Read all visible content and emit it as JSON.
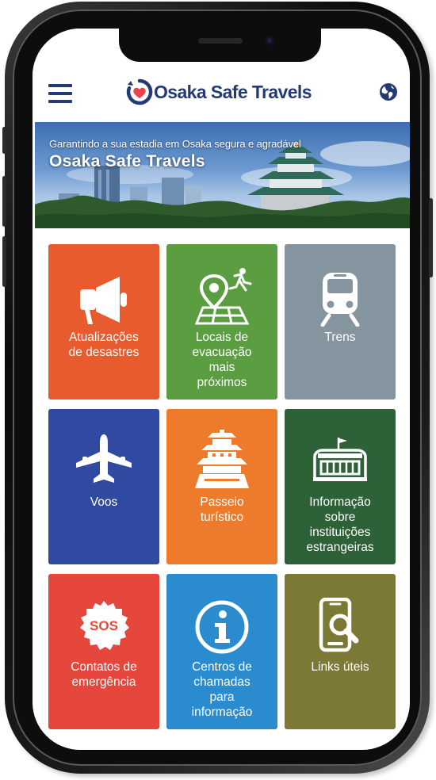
{
  "app": {
    "logo_text": "Osaka Safe Travels",
    "brand_color": "#253a73",
    "accent_color": "#e8434f"
  },
  "header": {
    "menu_icon": "hamburger-menu-icon",
    "language_icon": "globe-icon"
  },
  "banner": {
    "subtitle": "Garantindo a sua estadia em Osaka segura e agradável",
    "title": "Osaka Safe Travels"
  },
  "tiles": [
    {
      "label": "Atualizações\nde desastres",
      "icon": "megaphone-icon",
      "color": "#e85b2f"
    },
    {
      "label": "Locais de\nevacuação\nmais\npróximos",
      "icon": "evacuation-map-icon",
      "color": "#5b9d41"
    },
    {
      "label": "Trens",
      "icon": "train-icon",
      "color": "#8595a0"
    },
    {
      "label": "Voos",
      "icon": "airplane-icon",
      "color": "#2f4aa0"
    },
    {
      "label": "Passeio\nturístico",
      "icon": "castle-icon",
      "color": "#ee7a2b"
    },
    {
      "label": "Informação\nsobre\ninstituições\nestrangeiras",
      "icon": "embassy-building-icon",
      "color": "#2d6138"
    },
    {
      "label": "Contatos de\nemergência",
      "icon": "sos-icon",
      "color": "#e6473c",
      "icon_text": "SOS"
    },
    {
      "label": "Centros de\nchamadas\npara\ninformação",
      "icon": "information-icon",
      "color": "#2a8bcf"
    },
    {
      "label": "Links úteis",
      "icon": "search-phone-icon",
      "color": "#7c7835"
    }
  ]
}
